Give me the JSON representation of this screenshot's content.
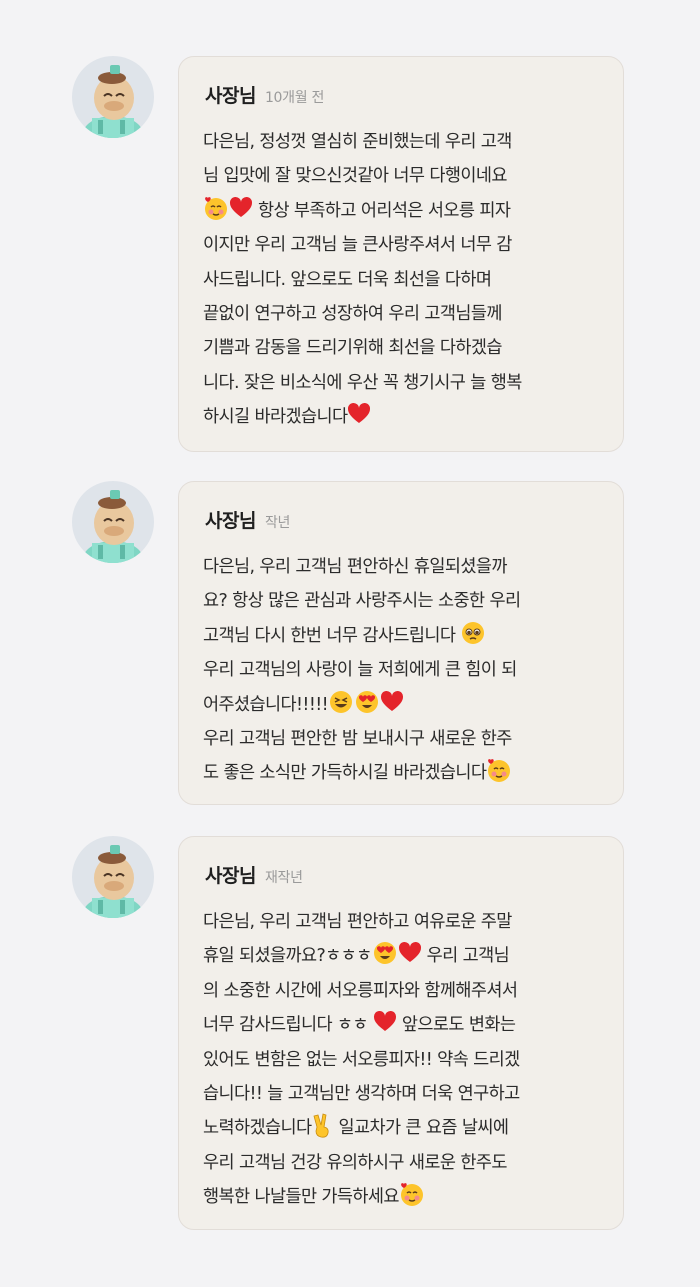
{
  "reviews": [
    {
      "name": "사장님",
      "time": "10개월 전",
      "lines": [
        [
          "다은님, 정성껏 열심히 준비했는데 우리 고객"
        ],
        [
          "님 입맛에 잘 맞으신것같아 너무 다행이네요"
        ],
        [
          "",
          " 항상 부족하고 어리석은 서오릉 피자"
        ],
        [
          "이지만 우리 고객님 늘 큰사랑주셔서 너무 감"
        ],
        [
          "사드립니다. 앞으로도 더욱 최선을 다하며"
        ],
        [
          "끝없이 연구하고 성장하여 우리 고객님들께"
        ],
        [
          "기쁨과 감동을 드리기위해 최선을 다하겠습"
        ],
        [
          "니다. 잦은 비소식에 우산 꼭 챙기시구 늘 행복"
        ],
        [
          "하시길 바라겠습니다"
        ]
      ]
    },
    {
      "name": "사장님",
      "time": "작년",
      "lines": [
        [
          "다은님, 우리 고객님 편안하신 휴일되셨을까"
        ],
        [
          "요? 항상 많은 관심과 사랑주시는 소중한 우리"
        ],
        [
          "고객님 다시 한번 너무 감사드립니다 "
        ],
        [
          "우리 고객님의 사랑이 늘 저희에게 큰 힘이 되"
        ],
        [
          "어주셨습니다!!!!!"
        ],
        [
          "우리 고객님 편안한 밤 보내시구 새로운 한주"
        ],
        [
          "도 좋은 소식만 가득하시길 바라겠습니다"
        ]
      ]
    },
    {
      "name": "사장님",
      "time": "재작년",
      "lines": [
        [
          "다은님, 우리 고객님 편안하고 여유로운 주말"
        ],
        [
          "휴일 되셨을까요?ㅎㅎㅎ",
          " 우리 고객님"
        ],
        [
          "의 소중한 시간에 서오릉피자와 함께해주셔서"
        ],
        [
          "너무 감사드립니다 ㅎㅎ ",
          " 앞으로도 변화는"
        ],
        [
          "있어도 변함은 없는 서오릉피자!! 약속 드리겠"
        ],
        [
          "습니다!! 늘 고객님만 생각하며 더욱 연구하고"
        ],
        [
          "노력하겠습니다",
          " 일교차가 큰 요즘 날씨에"
        ],
        [
          "우리 고객님 건강 유의하시구 새로운 한주도"
        ],
        [
          "행복한 나날들만 가득하세요"
        ]
      ]
    }
  ]
}
